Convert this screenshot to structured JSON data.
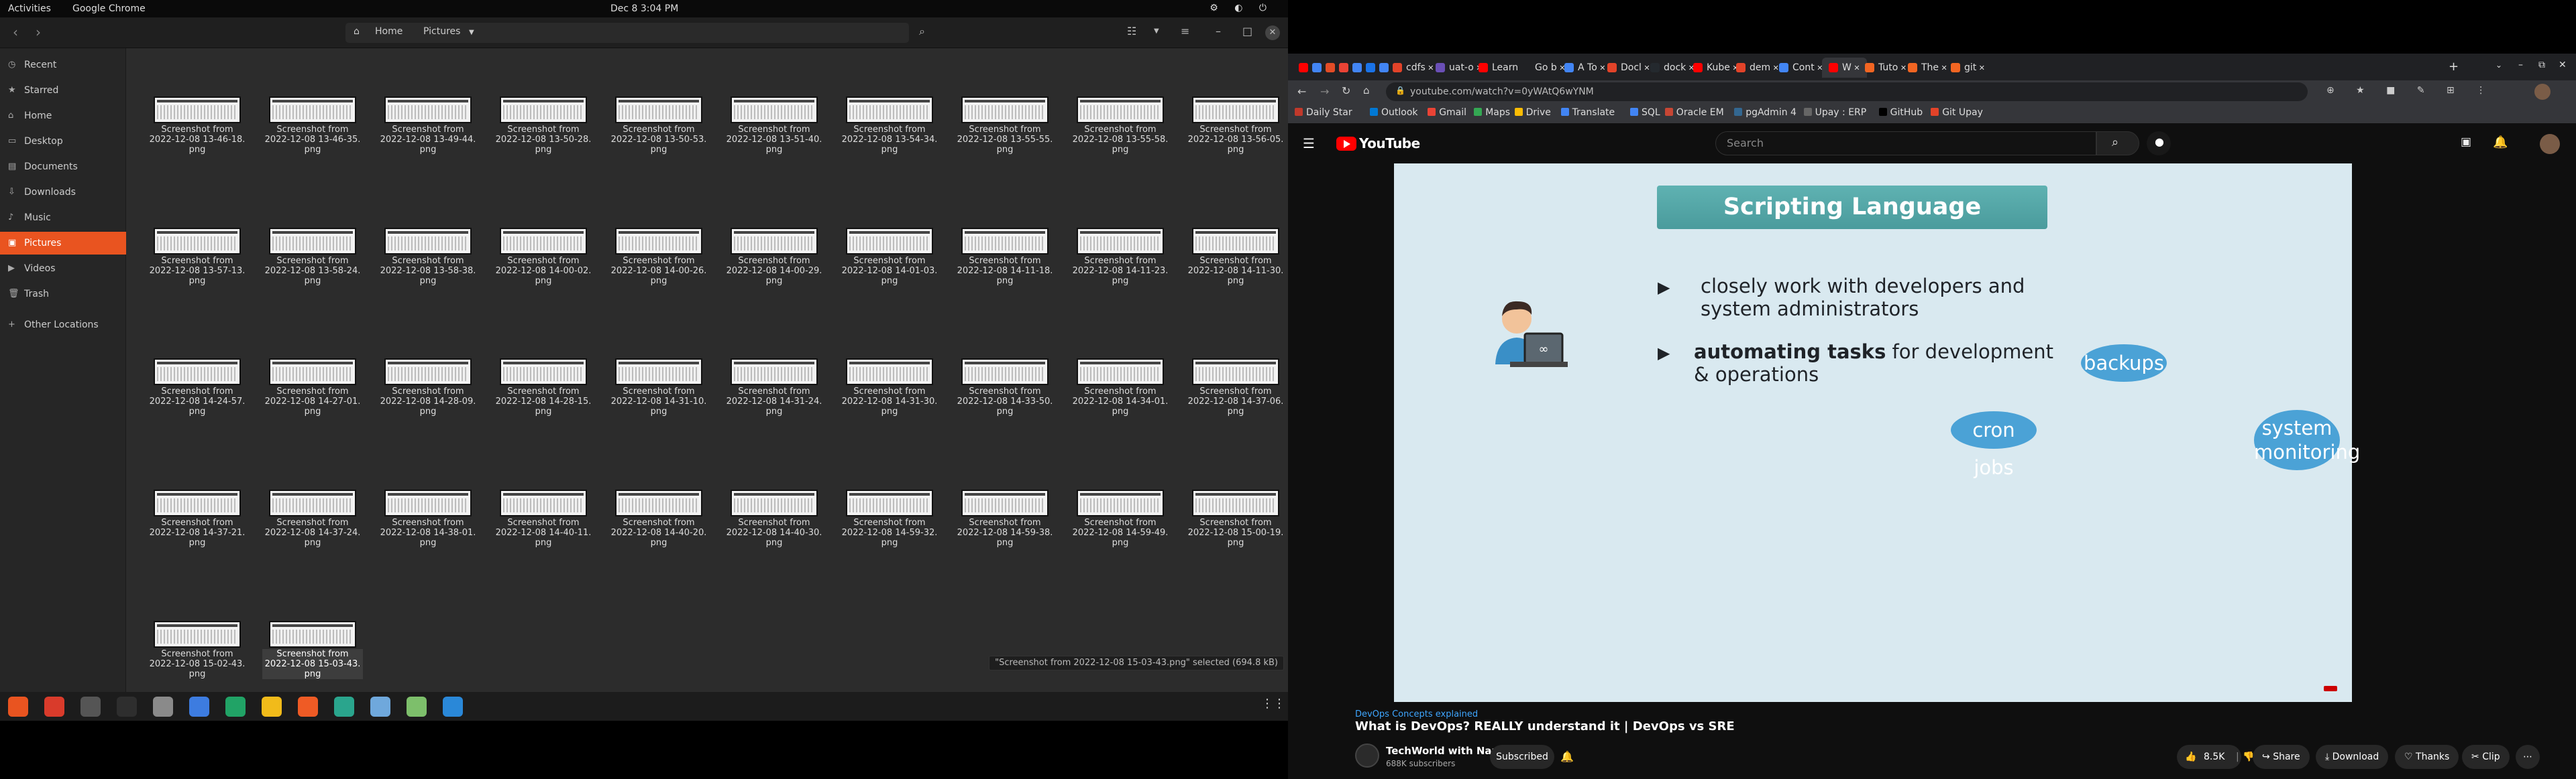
{
  "gnome_bar": {
    "activities": "Activities",
    "app_name": "Google Chrome",
    "clock": "Dec 8  3:04 PM",
    "sys_icons": "⚙ ◐ ⏻"
  },
  "files": {
    "path": {
      "home": "Home",
      "current": "Pictures"
    },
    "sidebar": [
      {
        "label": "Recent",
        "icon": "clock-icon",
        "glyph": "◷"
      },
      {
        "label": "Starred",
        "icon": "star-icon",
        "glyph": "★"
      },
      {
        "label": "Home",
        "icon": "home-icon",
        "glyph": "⌂"
      },
      {
        "label": "Desktop",
        "icon": "desktop-icon",
        "glyph": "▭"
      },
      {
        "label": "Documents",
        "icon": "documents-icon",
        "glyph": "▤"
      },
      {
        "label": "Downloads",
        "icon": "downloads-icon",
        "glyph": "⇩"
      },
      {
        "label": "Music",
        "icon": "music-icon",
        "glyph": "♪"
      },
      {
        "label": "Pictures",
        "icon": "pictures-icon",
        "glyph": "▣"
      },
      {
        "label": "Videos",
        "icon": "videos-icon",
        "glyph": "▶"
      },
      {
        "label": "Trash",
        "icon": "trash-icon",
        "glyph": "🗑"
      },
      {
        "label": "Other Locations",
        "icon": "plus-icon",
        "glyph": "+"
      }
    ],
    "files": [
      {
        "l1": "Screenshot from",
        "l2": "2022-12-08 13-46-18.",
        "l3": "png"
      },
      {
        "l1": "Screenshot from",
        "l2": "2022-12-08 13-46-35.",
        "l3": "png"
      },
      {
        "l1": "Screenshot from",
        "l2": "2022-12-08 13-49-44.",
        "l3": "png"
      },
      {
        "l1": "Screenshot from",
        "l2": "2022-12-08 13-50-28.",
        "l3": "png"
      },
      {
        "l1": "Screenshot from",
        "l2": "2022-12-08 13-50-53.",
        "l3": "png"
      },
      {
        "l1": "Screenshot from",
        "l2": "2022-12-08 13-51-40.",
        "l3": "png"
      },
      {
        "l1": "Screenshot from",
        "l2": "2022-12-08 13-54-34.",
        "l3": "png"
      },
      {
        "l1": "Screenshot from",
        "l2": "2022-12-08 13-55-55.",
        "l3": "png"
      },
      {
        "l1": "Screenshot from",
        "l2": "2022-12-08 13-55-58.",
        "l3": "png"
      },
      {
        "l1": "Screenshot from",
        "l2": "2022-12-08 13-56-05.",
        "l3": "png"
      },
      {
        "l1": "Screenshot from",
        "l2": "2022-12-08 13-57-13.",
        "l3": "png"
      },
      {
        "l1": "Screenshot from",
        "l2": "2022-12-08 13-58-24.",
        "l3": "png"
      },
      {
        "l1": "Screenshot from",
        "l2": "2022-12-08 13-58-38.",
        "l3": "png"
      },
      {
        "l1": "Screenshot from",
        "l2": "2022-12-08 14-00-02.",
        "l3": "png"
      },
      {
        "l1": "Screenshot from",
        "l2": "2022-12-08 14-00-26.",
        "l3": "png"
      },
      {
        "l1": "Screenshot from",
        "l2": "2022-12-08 14-00-29.",
        "l3": "png"
      },
      {
        "l1": "Screenshot from",
        "l2": "2022-12-08 14-01-03.",
        "l3": "png"
      },
      {
        "l1": "Screenshot from",
        "l2": "2022-12-08 14-11-18.",
        "l3": "png"
      },
      {
        "l1": "Screenshot from",
        "l2": "2022-12-08 14-11-23.",
        "l3": "png"
      },
      {
        "l1": "Screenshot from",
        "l2": "2022-12-08 14-11-30.",
        "l3": "png"
      },
      {
        "l1": "Screenshot from",
        "l2": "2022-12-08 14-24-57.",
        "l3": "png"
      },
      {
        "l1": "Screenshot from",
        "l2": "2022-12-08 14-27-01.",
        "l3": "png"
      },
      {
        "l1": "Screenshot from",
        "l2": "2022-12-08 14-28-09.",
        "l3": "png"
      },
      {
        "l1": "Screenshot from",
        "l2": "2022-12-08 14-28-15.",
        "l3": "png"
      },
      {
        "l1": "Screenshot from",
        "l2": "2022-12-08 14-31-10.",
        "l3": "png"
      },
      {
        "l1": "Screenshot from",
        "l2": "2022-12-08 14-31-24.",
        "l3": "png"
      },
      {
        "l1": "Screenshot from",
        "l2": "2022-12-08 14-31-30.",
        "l3": "png"
      },
      {
        "l1": "Screenshot from",
        "l2": "2022-12-08 14-33-50.",
        "l3": "png"
      },
      {
        "l1": "Screenshot from",
        "l2": "2022-12-08 14-34-01.",
        "l3": "png"
      },
      {
        "l1": "Screenshot from",
        "l2": "2022-12-08 14-37-06.",
        "l3": "png"
      },
      {
        "l1": "Screenshot from",
        "l2": "2022-12-08 14-37-21.",
        "l3": "png"
      },
      {
        "l1": "Screenshot from",
        "l2": "2022-12-08 14-37-24.",
        "l3": "png"
      },
      {
        "l1": "Screenshot from",
        "l2": "2022-12-08 14-38-01.",
        "l3": "png"
      },
      {
        "l1": "Screenshot from",
        "l2": "2022-12-08 14-40-11.",
        "l3": "png"
      },
      {
        "l1": "Screenshot from",
        "l2": "2022-12-08 14-40-20.",
        "l3": "png"
      },
      {
        "l1": "Screenshot from",
        "l2": "2022-12-08 14-40-30.",
        "l3": "png"
      },
      {
        "l1": "Screenshot from",
        "l2": "2022-12-08 14-59-32.",
        "l3": "png"
      },
      {
        "l1": "Screenshot from",
        "l2": "2022-12-08 14-59-38.",
        "l3": "png"
      },
      {
        "l1": "Screenshot from",
        "l2": "2022-12-08 14-59-49.",
        "l3": "png"
      },
      {
        "l1": "Screenshot from",
        "l2": "2022-12-08 15-00-19.",
        "l3": "png"
      },
      {
        "l1": "Screenshot from",
        "l2": "2022-12-08 15-02-43.",
        "l3": "png"
      },
      {
        "l1": "Screenshot from",
        "l2": "2022-12-08 15-03-43.",
        "l3": "png",
        "selected": true
      }
    ],
    "status": "\"Screenshot from 2022-12-08 15-03-43.png\" selected  (694.8 kB)"
  },
  "dock": {
    "apps": [
      {
        "name": "ubuntu-software-icon",
        "color": "#e95420"
      },
      {
        "name": "anydesk-icon",
        "color": "#d93b2b"
      },
      {
        "name": "obs-icon",
        "color": "#555555"
      },
      {
        "name": "terminal-icon",
        "color": "#2e2e2e"
      },
      {
        "name": "files-icon",
        "color": "#8a8a8a"
      },
      {
        "name": "docs-icon",
        "color": "#3d7ce0"
      },
      {
        "name": "sheets-icon",
        "color": "#21a366"
      },
      {
        "name": "chrome-icon",
        "color": "#f1bb1a"
      },
      {
        "name": "postman-icon",
        "color": "#ef5b25"
      },
      {
        "name": "screenshot-tool-icon",
        "color": "#2aa58d"
      },
      {
        "name": "pycharm-icon",
        "color": "#6fa8dc"
      },
      {
        "name": "image-viewer-icon",
        "color": "#7dbf6b"
      },
      {
        "name": "vscode-icon",
        "color": "#2a88d8"
      }
    ],
    "grid_glyph": "⋮⋮⋮"
  },
  "chrome": {
    "tabs": [
      {
        "label": "",
        "color": "#ff0000"
      },
      {
        "label": "",
        "color": "#4285f4"
      },
      {
        "label": "",
        "color": "#e34c26"
      },
      {
        "label": "",
        "color": "#ea4335"
      },
      {
        "label": "",
        "color": "#4285f4"
      },
      {
        "label": "",
        "color": "#1a73e8"
      },
      {
        "label": "",
        "color": "#4285f4"
      },
      {
        "label": "cdfs",
        "color": "#e24329"
      },
      {
        "label": "uat-o",
        "color": "#6a4fb6"
      },
      {
        "label": "Learn",
        "color": "#ff0000"
      },
      {
        "label": "Go b",
        "color": "#202124"
      },
      {
        "label": "A To",
        "color": "#4285f4"
      },
      {
        "label": "Docl",
        "color": "#e24329"
      },
      {
        "label": "dock",
        "color": "#24292e"
      },
      {
        "label": "Kube",
        "color": "#ff0000"
      },
      {
        "label": "dem",
        "color": "#e24329"
      },
      {
        "label": "Cont",
        "color": "#4285f4"
      },
      {
        "label": "W",
        "color": "#ff0000"
      },
      {
        "label": "Tuto",
        "color": "#f26522"
      },
      {
        "label": "The",
        "color": "#f26522"
      },
      {
        "label": "git",
        "color": "#f26522"
      }
    ],
    "url": "youtube.com/watch?v=0yWAtQ6wYNM",
    "bookmarks": [
      {
        "label": "Daily Star",
        "color": "#c0392b"
      },
      {
        "label": "Outlook",
        "color": "#0078d4"
      },
      {
        "label": "Gmail",
        "color": "#ea4335"
      },
      {
        "label": "Maps",
        "color": "#34a853"
      },
      {
        "label": "Drive",
        "color": "#fbbc04"
      },
      {
        "label": "Translate",
        "color": "#4285f4"
      },
      {
        "label": "SQL",
        "color": "#4285f4"
      },
      {
        "label": "Oracle EM",
        "color": "#c74634"
      },
      {
        "label": "pgAdmin 4",
        "color": "#336791"
      },
      {
        "label": "Upay : ERP",
        "color": "#666666"
      },
      {
        "label": "GitHub",
        "color": "#000000"
      },
      {
        "label": "Git Upay",
        "color": "#e24329"
      }
    ]
  },
  "youtube": {
    "logo": "YouTube",
    "search_placeholder": "Search",
    "slide": {
      "title": "Scripting Language",
      "bullet1": "closely work with developers and system administrators",
      "bullet2_bold": "automating tasks",
      "bullet2_rest": " for development & operations",
      "bubble_backups": "backups",
      "bubble_cron": "cron jobs",
      "bubble_monitoring": "system monitoring"
    },
    "video_tag": "DevOps Concepts explained",
    "video_title": "What is DevOps? REALLY understand it | DevOps vs SRE",
    "channel": "TechWorld with Nana",
    "subscribers": "688K subscribers",
    "subscribed_label": "Subscribed",
    "likes": "8.5K",
    "share": "Share",
    "download": "Download",
    "thanks": "Thanks",
    "clip": "Clip",
    "more": "⋯"
  }
}
